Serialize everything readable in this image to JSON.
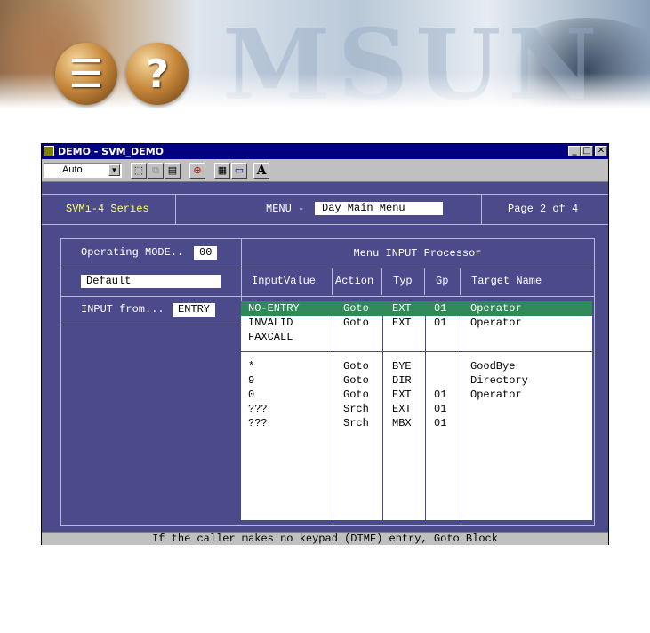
{
  "banner": {
    "watermark": "MSUN",
    "icon1": "☰",
    "icon2": "?"
  },
  "window": {
    "title": "DEMO - SVM_DEMO",
    "buttons": {
      "minimize": "_",
      "maximize": "□",
      "close": "✕"
    }
  },
  "toolbar": {
    "zoom_value": "Auto",
    "font_button": "A"
  },
  "header": {
    "series": "SVMi-4 Series",
    "menu_label": "MENU -",
    "menu_name": "Day Main Menu",
    "page": "Page 2 of 4"
  },
  "left_panel": {
    "mode_label": "Operating MODE..",
    "mode_value": "00",
    "default_value": "Default",
    "input_from_label": "INPUT from...",
    "input_from_value": "ENTRY"
  },
  "processor": {
    "title": "Menu INPUT Processor",
    "columns": [
      "InputValue",
      "Action",
      "Typ",
      "Gp",
      "Target Name"
    ],
    "rows_top": [
      {
        "input": "NO-ENTRY",
        "action": "Goto",
        "typ": "EXT",
        "gp": "01",
        "target": "Operator",
        "selected": true
      },
      {
        "input": "INVALID",
        "action": "Goto",
        "typ": "EXT",
        "gp": "01",
        "target": "Operator",
        "selected": false
      },
      {
        "input": "FAXCALL",
        "action": "",
        "typ": "",
        "gp": "",
        "target": "",
        "selected": false
      }
    ],
    "rows_bottom": [
      {
        "input": "*",
        "action": "Goto",
        "typ": "BYE",
        "gp": "",
        "target": "GoodBye"
      },
      {
        "input": "9",
        "action": "Goto",
        "typ": "DIR",
        "gp": "",
        "target": "Directory"
      },
      {
        "input": "0",
        "action": "Goto",
        "typ": "EXT",
        "gp": "01",
        "target": "Operator"
      },
      {
        "input": "???",
        "action": "Srch",
        "typ": "EXT",
        "gp": "01",
        "target": ""
      },
      {
        "input": "???",
        "action": "Srch",
        "typ": "MBX",
        "gp": "01",
        "target": ""
      }
    ]
  },
  "status": {
    "text": "If the caller makes no keypad (DTMF) entry, Goto Block"
  },
  "colors": {
    "title_bar": "#000080",
    "client_bg": "#4b4b8c",
    "selection": "#2e8b57",
    "series_text": "#ffff66"
  }
}
